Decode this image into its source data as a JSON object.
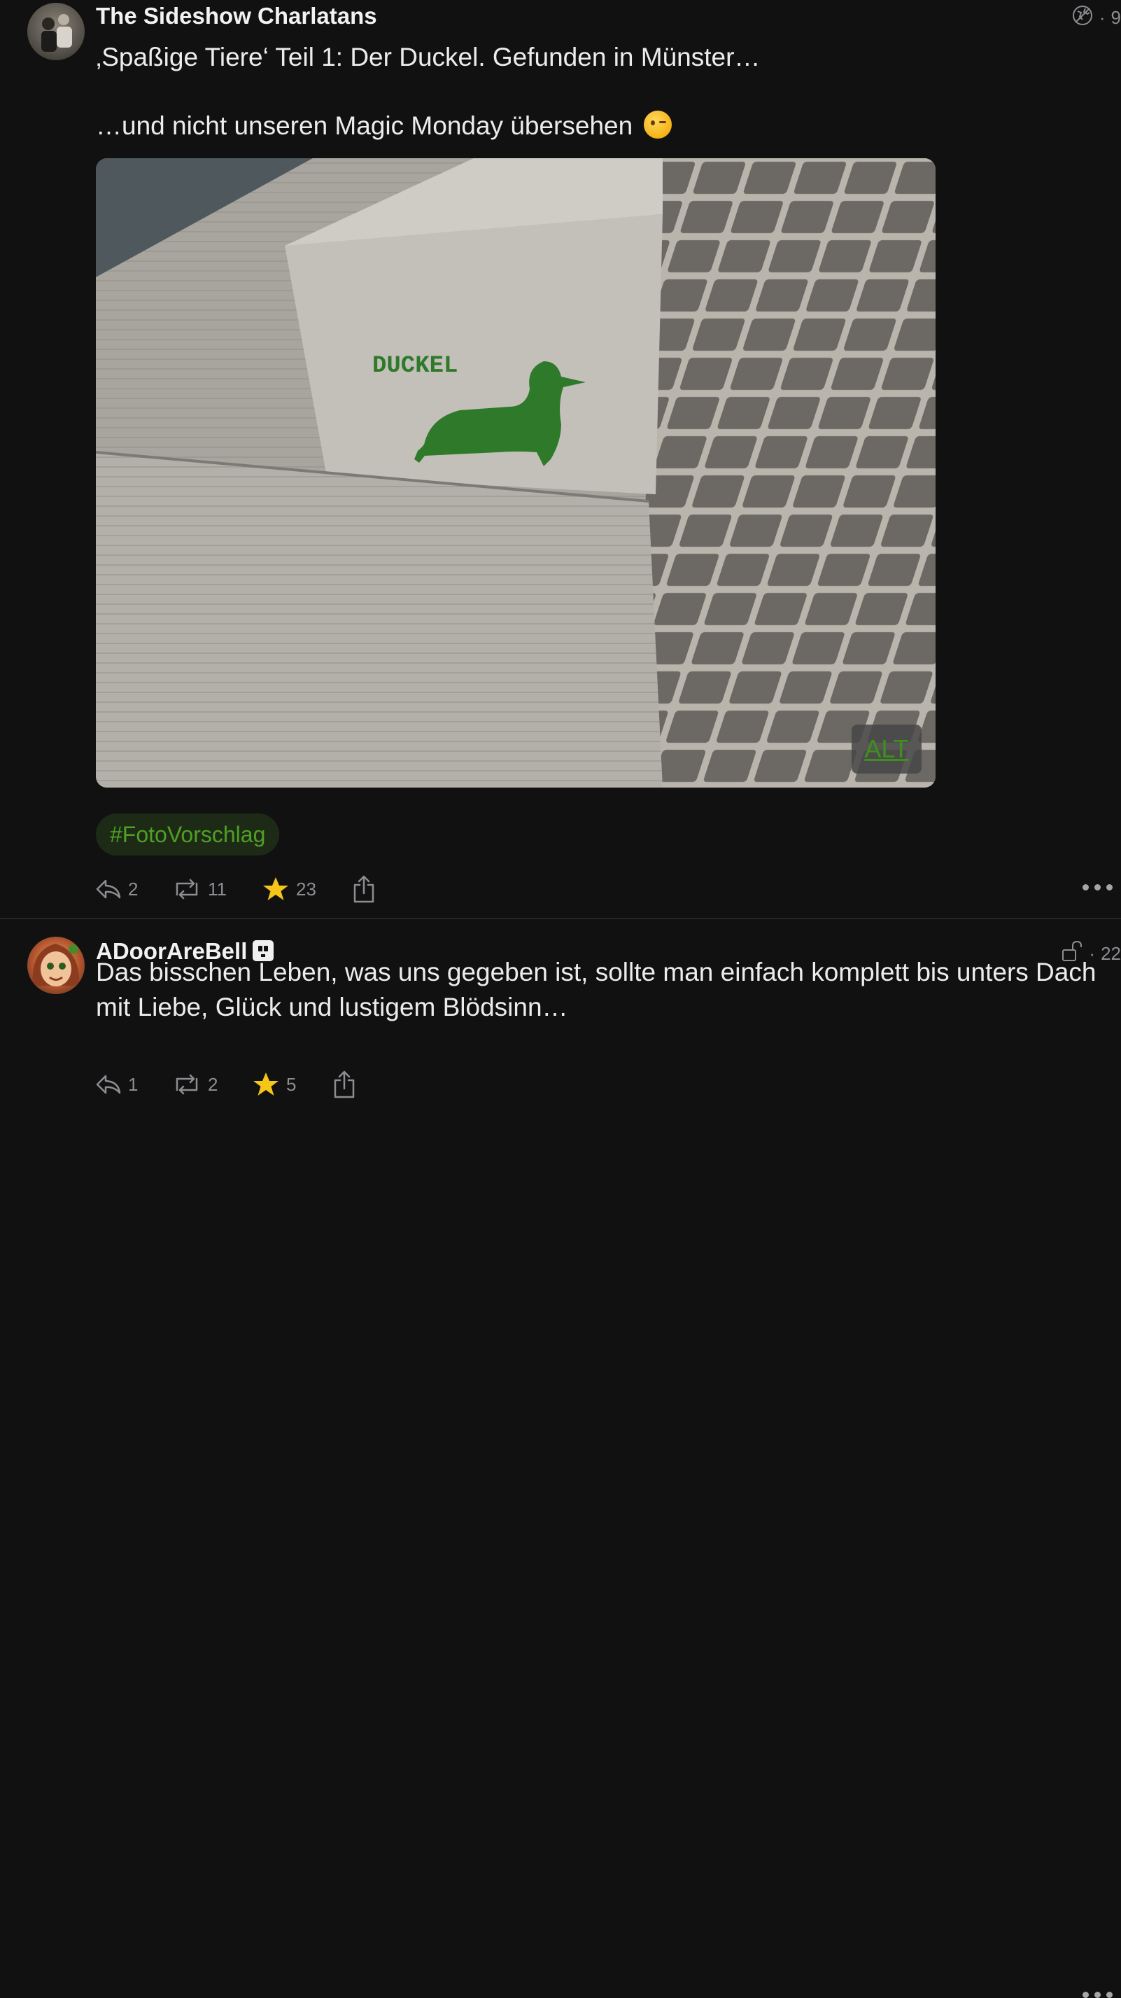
{
  "posts": [
    {
      "author": "The Sideshow Charlatans",
      "visibility_icon": "globe-icon",
      "meta_separator": "·",
      "time": "9",
      "text_line1": "‚Spaßige Tiere‘ Teil 1: Der Duckel. Gefunden in Münster…",
      "text_line2": "…und nicht unseren Magic Monday übersehen",
      "emoji": "wink-emoji",
      "image": {
        "stencil_text": "DUCKEL",
        "alt_label": "ALT",
        "stencil_color": "#2f7a2a"
      },
      "hashtag": "#FotoVorschlag",
      "replies": "2",
      "boosts": "11",
      "favourites": "23"
    },
    {
      "author": "ADoorAreBell",
      "bot_badge": "bot-icon",
      "visibility_icon": "unlock-icon",
      "meta_separator": "·",
      "time": "22",
      "text": "Das bisschen Leben, was uns gegeben ist, sollte man einfach komplett bis unters Dach mit Liebe, Glück und lustigem Blödsinn…",
      "replies": "1",
      "boosts": "2",
      "favourites": "5"
    }
  ],
  "colors": {
    "background": "#111112",
    "text": "#ececec",
    "muted": "#8d8d92",
    "accent_green": "#4f9f25",
    "star": "#f5c518"
  }
}
